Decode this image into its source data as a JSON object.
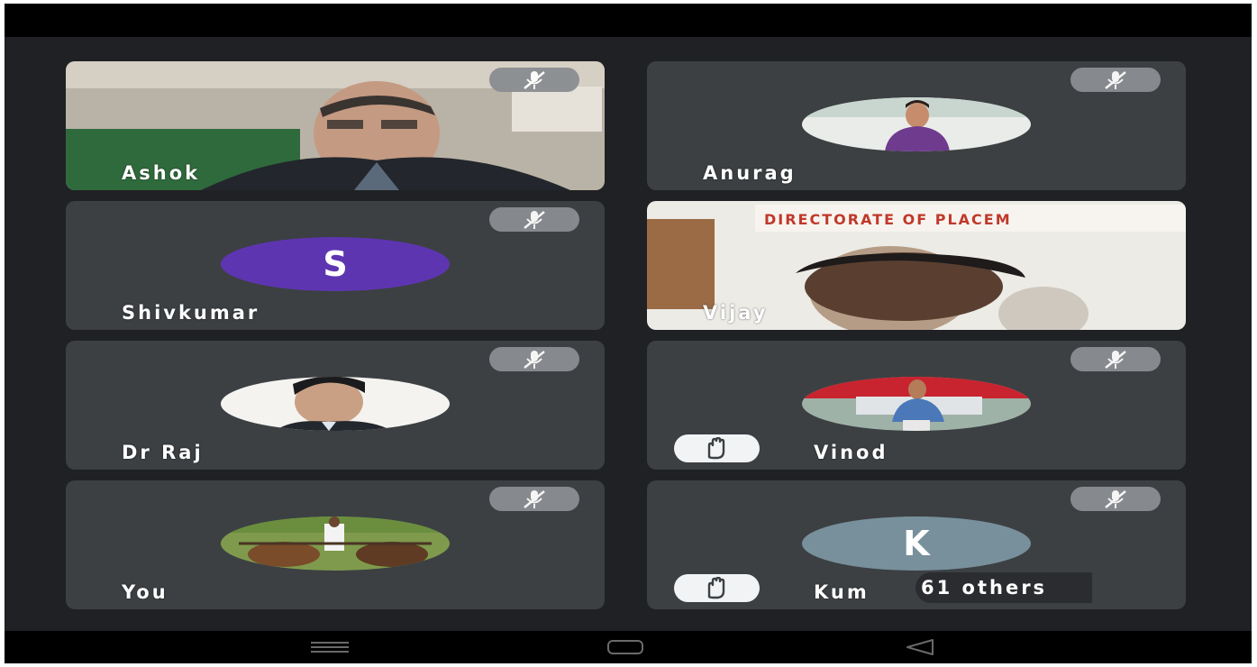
{
  "participants": [
    {
      "name": "Ashok",
      "kind": "video",
      "muted": true
    },
    {
      "name": "Anurag",
      "kind": "photo",
      "muted": true
    },
    {
      "name": "Shivkumar",
      "kind": "letter",
      "letter": "S",
      "avatar_color": "#5e35b1",
      "muted": true
    },
    {
      "name": "Vijay",
      "kind": "video",
      "muted": false
    },
    {
      "name": "Dr Raj",
      "kind": "photo",
      "muted": true
    },
    {
      "name": "Vinod",
      "kind": "photo",
      "muted": true,
      "hand_raised": true
    },
    {
      "name": "You",
      "kind": "photo",
      "muted": true
    },
    {
      "name": "Kum",
      "kind": "letter",
      "letter": "K",
      "avatar_color": "#78909c",
      "muted": true,
      "hand_raised": true
    }
  ],
  "video_sign_text": "DIRECTORATE OF PLACEM",
  "others_label": "61 others",
  "icons": {
    "mute": "mic-off-icon",
    "hand": "raised-hand-icon",
    "nav": [
      "recents-icon",
      "home-icon",
      "back-icon"
    ]
  },
  "colors": {
    "background": "#202124",
    "tile": "#3c4043",
    "mute_pill": "#8a8d91"
  }
}
